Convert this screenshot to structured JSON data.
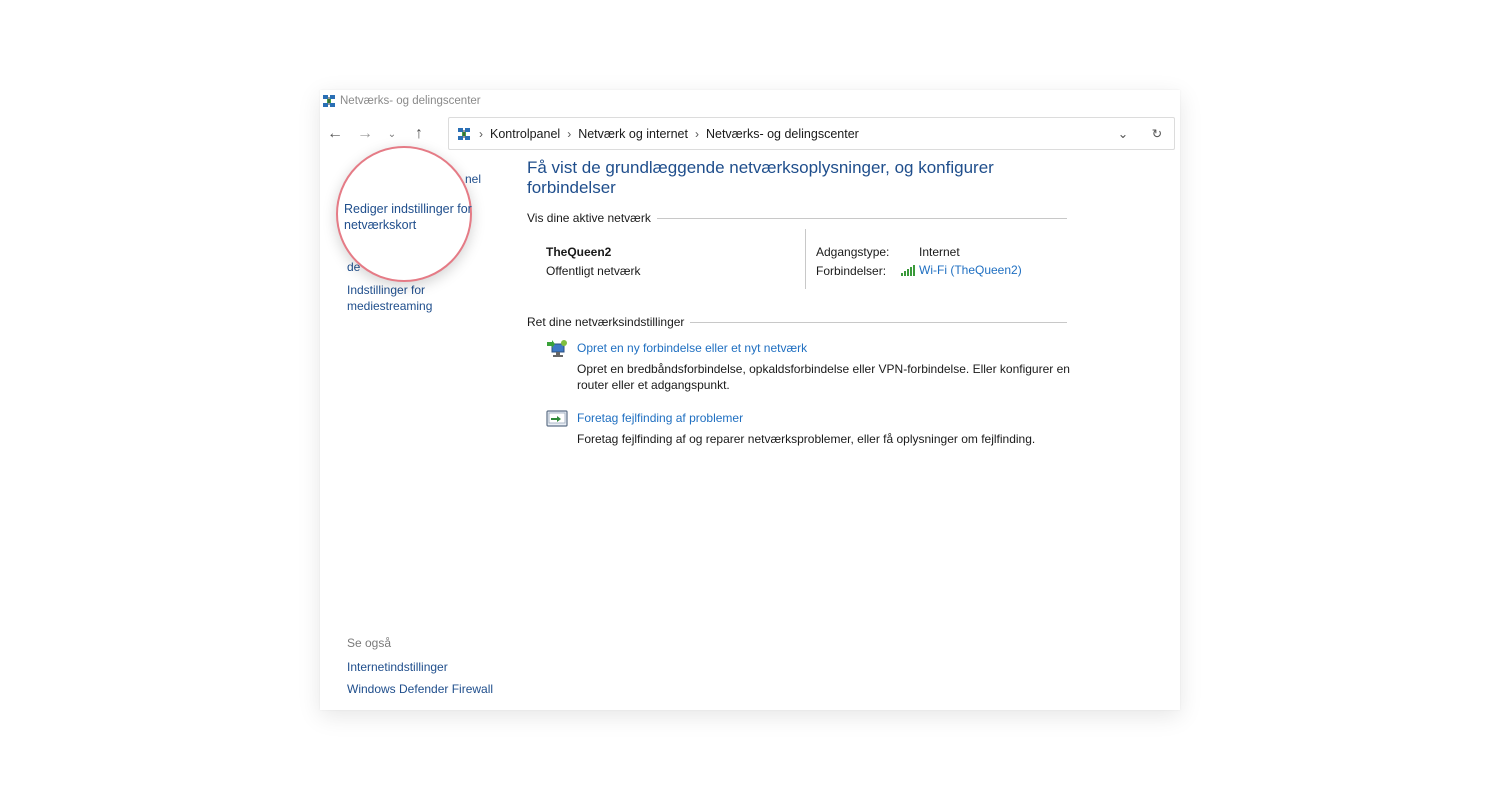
{
  "window": {
    "title": "Netværks- og delingscenter"
  },
  "nav": {
    "back": "←",
    "forward": "→",
    "recent": "⌄",
    "up": "↑"
  },
  "address": {
    "crumbs": [
      "Kontrolpanel",
      "Netværk og internet",
      "Netværks- og delingscenter"
    ],
    "separator": "›",
    "dropdown": "⌄",
    "refresh": "↻"
  },
  "sidebar": {
    "partial_items": [
      "nel",
      "de"
    ],
    "highlighted_item": "Rediger indstillinger for netværkskort",
    "items": [
      "Indstillinger for mediestreaming"
    ]
  },
  "see_also": {
    "title": "Se også",
    "links": [
      "Internetindstillinger",
      "Windows Defender Firewall"
    ]
  },
  "main": {
    "title": "Få vist de grundlæggende netværksoplysninger, og konfigurer forbindelser",
    "active_networks_heading": "Vis dine aktive netværk",
    "network": {
      "name": "TheQueen2",
      "type": "Offentligt netværk",
      "access_label": "Adgangstype:",
      "access_value": "Internet",
      "connections_label": "Forbindelser:",
      "connections_value": "Wi-Fi (TheQueen2)"
    },
    "settings_heading": "Ret dine netværksindstillinger",
    "tasks": [
      {
        "link": "Opret en ny forbindelse eller et nyt netværk",
        "description": "Opret en bredbåndsforbindelse, opkaldsforbindelse eller VPN-forbindelse. Eller konfigurer en router eller et adgangspunkt.",
        "icon": "new-connection-icon"
      },
      {
        "link": "Foretag fejlfinding af problemer",
        "description": "Foretag fejlfinding af og reparer netværksproblemer, eller få oplysninger om fejlfinding.",
        "icon": "troubleshoot-icon"
      }
    ]
  },
  "colors": {
    "link": "#1f6fc1",
    "title_blue": "#1f4e8c",
    "spotlight_ring": "#e57b86",
    "wifi_green": "#3a9a3a"
  }
}
